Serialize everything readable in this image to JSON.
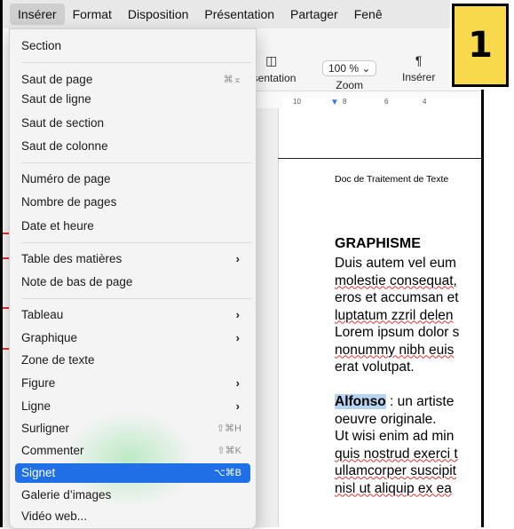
{
  "menubar": {
    "items": [
      "Insérer",
      "Format",
      "Disposition",
      "Présentation",
      "Partager",
      "Fenê"
    ]
  },
  "toolbar": {
    "presentation_label": "ésentation",
    "zoom_value": "100 % ⌄",
    "zoom_label": "Zoom",
    "insert_label": "Insérer"
  },
  "ruler": {
    "ticks": [
      "10",
      "8",
      "6",
      "4"
    ]
  },
  "document": {
    "header": "Doc de Traitement de Texte",
    "title": "GRAPHISME",
    "para1": [
      "Duis autem vel eum",
      "molestie consequat,",
      "eros et accumsan et",
      "luptatum zzril delen",
      "Lorem ipsum dolor s",
      "nonummy nibh euis",
      "erat volutpat."
    ],
    "highlight": "Alfonso",
    "para2_first": " : un artiste",
    "para2": [
      "oeuvre originale.",
      "Ut wisi enim ad min",
      "quis nostrud exerci t",
      "ullamcorper suscipit",
      "nisl ut aliquip ex ea"
    ]
  },
  "callout": {
    "number": "1"
  },
  "menu": {
    "items": [
      {
        "label": "Section"
      },
      {
        "label": "Saut de page",
        "shortcut": "⌘⌅"
      },
      {
        "label": "Saut de ligne"
      },
      {
        "label": "Saut de section"
      },
      {
        "label": "Saut de colonne"
      },
      {
        "label": "Numéro de page"
      },
      {
        "label": "Nombre de pages"
      },
      {
        "label": "Date et heure"
      },
      {
        "label": "Table des matières",
        "submenu": "›"
      },
      {
        "label": "Note de bas de page"
      },
      {
        "label": "Tableau",
        "submenu": "›"
      },
      {
        "label": "Graphique",
        "submenu": "›"
      },
      {
        "label": "Zone de texte"
      },
      {
        "label": "Figure",
        "submenu": "›"
      },
      {
        "label": "Ligne",
        "submenu": "›"
      },
      {
        "label": "Surligner",
        "shortcut": "⇧⌘H"
      },
      {
        "label": "Commenter",
        "shortcut": "⇧⌘K"
      },
      {
        "label": "Signet",
        "shortcut": "⌥⌘B",
        "selected": true
      },
      {
        "label": "Galerie d’images"
      },
      {
        "label": "Vidéo web..."
      }
    ]
  },
  "colors": {
    "selection": "#1f6fe6",
    "callout": "#f9d94c",
    "highlight": "#b6d4f2"
  }
}
